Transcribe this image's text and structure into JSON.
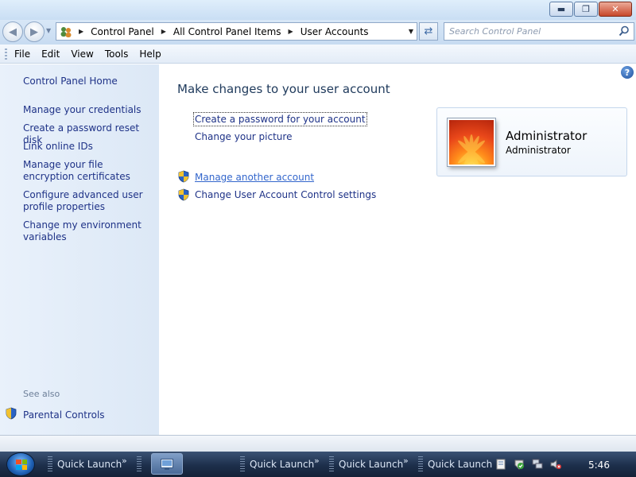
{
  "window": {
    "controls": {
      "minimize": "▬",
      "maximize": "❐",
      "close": "✕"
    }
  },
  "address_bar": {
    "breadcrumbs": [
      "Control Panel",
      "All Control Panel Items",
      "User Accounts"
    ],
    "search_placeholder": "Search Control Panel"
  },
  "menu": {
    "items": [
      "File",
      "Edit",
      "View",
      "Tools",
      "Help"
    ]
  },
  "left_pane": {
    "home": "Control Panel Home",
    "links": [
      "Manage your credentials",
      "Create a password reset disk",
      "Link online IDs",
      "Manage your file encryption certificates",
      "Configure advanced user profile properties",
      "Change my environment variables"
    ],
    "see_also_label": "See also",
    "see_also_items": [
      "Parental Controls"
    ]
  },
  "main": {
    "heading": "Make changes to your user account",
    "tasks": [
      "Create a password for your account",
      "Change your picture",
      "Manage another account",
      "Change User Account Control settings"
    ],
    "account": {
      "name": "Administrator",
      "role": "Administrator"
    }
  },
  "taskbar": {
    "quick_launch_label": "Quick Launch",
    "clock": "5:46"
  },
  "colors": {
    "link": "#1e3287",
    "heading": "#1e395b",
    "left_pane_bg": "#e3edf9",
    "taskbar": "#1d2f4b"
  },
  "icons": [
    "back-arrow-icon",
    "forward-arrow-icon",
    "users-icon",
    "refresh-icon",
    "search-icon",
    "help-icon",
    "uac-shield-icon",
    "windows-start-icon"
  ]
}
